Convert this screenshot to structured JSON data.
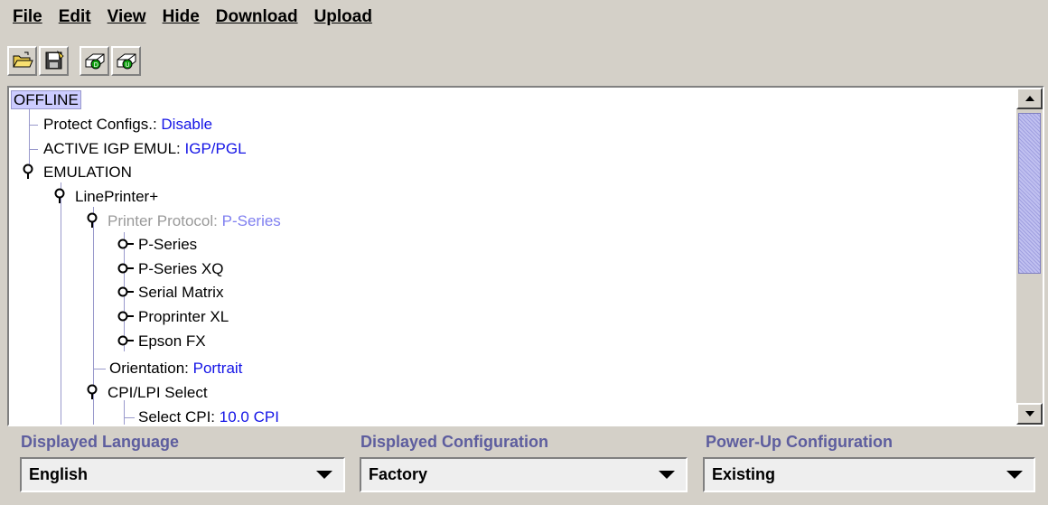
{
  "menu": {
    "file": "File",
    "edit": "Edit",
    "view": "View",
    "hide": "Hide",
    "download": "Download",
    "upload": "Upload"
  },
  "toolbar": {
    "icons": [
      "open-folder-icon",
      "save-disk-icon",
      "download-config-icon",
      "upload-config-icon"
    ]
  },
  "tree": {
    "root": "OFFLINE",
    "protect_label": "Protect Configs.: ",
    "protect_value": "Disable",
    "active_label": "ACTIVE IGP EMUL: ",
    "active_value": "IGP/PGL",
    "emulation": "EMULATION",
    "lineprinter": "LinePrinter+",
    "protocol_label": "Printer Protocol: ",
    "protocol_value": "P-Series",
    "protocols": [
      "P-Series",
      "P-Series XQ",
      "Serial Matrix",
      "Proprinter XL",
      "Epson FX"
    ],
    "orientation_label": "Orientation: ",
    "orientation_value": "Portrait",
    "cpilpi": "CPI/LPI Select",
    "selectcpi_label": "Select CPI: ",
    "selectcpi_value": "10.0 CPI"
  },
  "bottom": {
    "language_label": "Displayed Language",
    "language_value": "English",
    "config_label": "Displayed Configuration",
    "config_value": "Factory",
    "powerup_label": "Power-Up Configuration",
    "powerup_value": "Existing"
  },
  "colors": {
    "background": "#d4d0c8",
    "value_text": "#1414e6",
    "section_label": "#5d5d9e",
    "tree_line": "#9999cc"
  }
}
